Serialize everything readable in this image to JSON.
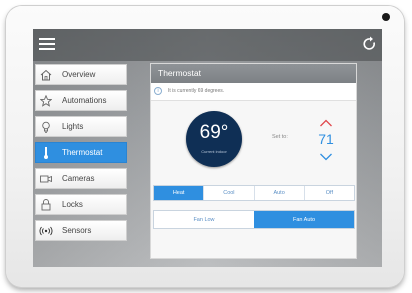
{
  "sidebar": {
    "items": [
      {
        "label": "Overview",
        "icon": "home-icon"
      },
      {
        "label": "Automations",
        "icon": "star-icon"
      },
      {
        "label": "Lights",
        "icon": "lightbulb-icon"
      },
      {
        "label": "Thermostat",
        "icon": "thermometer-icon",
        "active": true
      },
      {
        "label": "Cameras",
        "icon": "camera-icon"
      },
      {
        "label": "Locks",
        "icon": "lock-icon"
      },
      {
        "label": "Sensors",
        "icon": "signal-icon"
      }
    ]
  },
  "thermostat": {
    "title": "Thermostat",
    "info": "It is currently 69 degrees.",
    "current_temp": "69°",
    "current_label": "Current indoor",
    "set_to_label": "Set to:",
    "set_value": "71",
    "modes": [
      {
        "label": "Heat",
        "active": true
      },
      {
        "label": "Cool",
        "active": false
      },
      {
        "label": "Auto",
        "active": false
      },
      {
        "label": "Off",
        "active": false
      }
    ],
    "fan": [
      {
        "label": "Fan Low",
        "active": false
      },
      {
        "label": "Fan Auto",
        "active": true
      }
    ]
  },
  "colors": {
    "accent": "#2f8fe0",
    "temp_circle": "#0f2f55",
    "up_arrow": "#e0474c"
  }
}
